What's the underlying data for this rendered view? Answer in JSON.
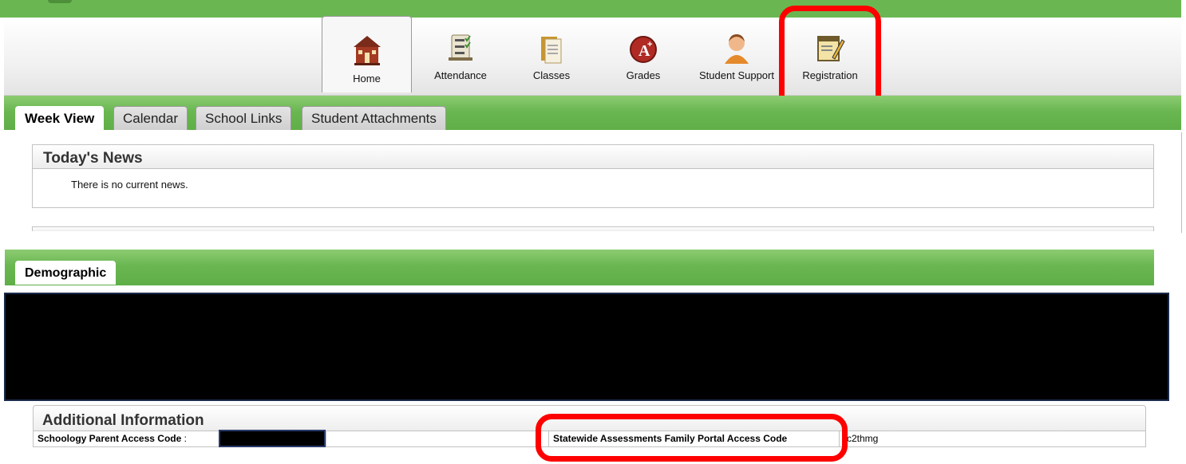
{
  "nav": {
    "items": [
      {
        "label": "Home",
        "icon": "schoolhouse-icon",
        "active": true
      },
      {
        "label": "Attendance",
        "icon": "checklist-icon",
        "active": false
      },
      {
        "label": "Classes",
        "icon": "books-icon",
        "active": false
      },
      {
        "label": "Grades",
        "icon": "grade-a-plus-icon",
        "active": false
      },
      {
        "label": "Student Support",
        "icon": "student-icon",
        "active": false
      },
      {
        "label": "Registration",
        "icon": "clipboard-pencil-icon",
        "active": false
      }
    ]
  },
  "tabs": [
    {
      "label": "Week View",
      "active": true
    },
    {
      "label": "Calendar",
      "active": false
    },
    {
      "label": "School Links",
      "active": false
    },
    {
      "label": "Student Attachments",
      "active": false
    }
  ],
  "news": {
    "title": "Today's News",
    "message": "There is no current news."
  },
  "demographic_tab": "Demographic",
  "additional": {
    "title": "Additional Information",
    "schoology_label": "Schoology Parent Access Code",
    "schoology_sep": ":",
    "statewide_label": "Statewide Assessments Family Portal Access Code",
    "statewide_value": "c2thmg"
  },
  "colors": {
    "brand_green": "#6ab752",
    "highlight_red": "#ff0000"
  }
}
